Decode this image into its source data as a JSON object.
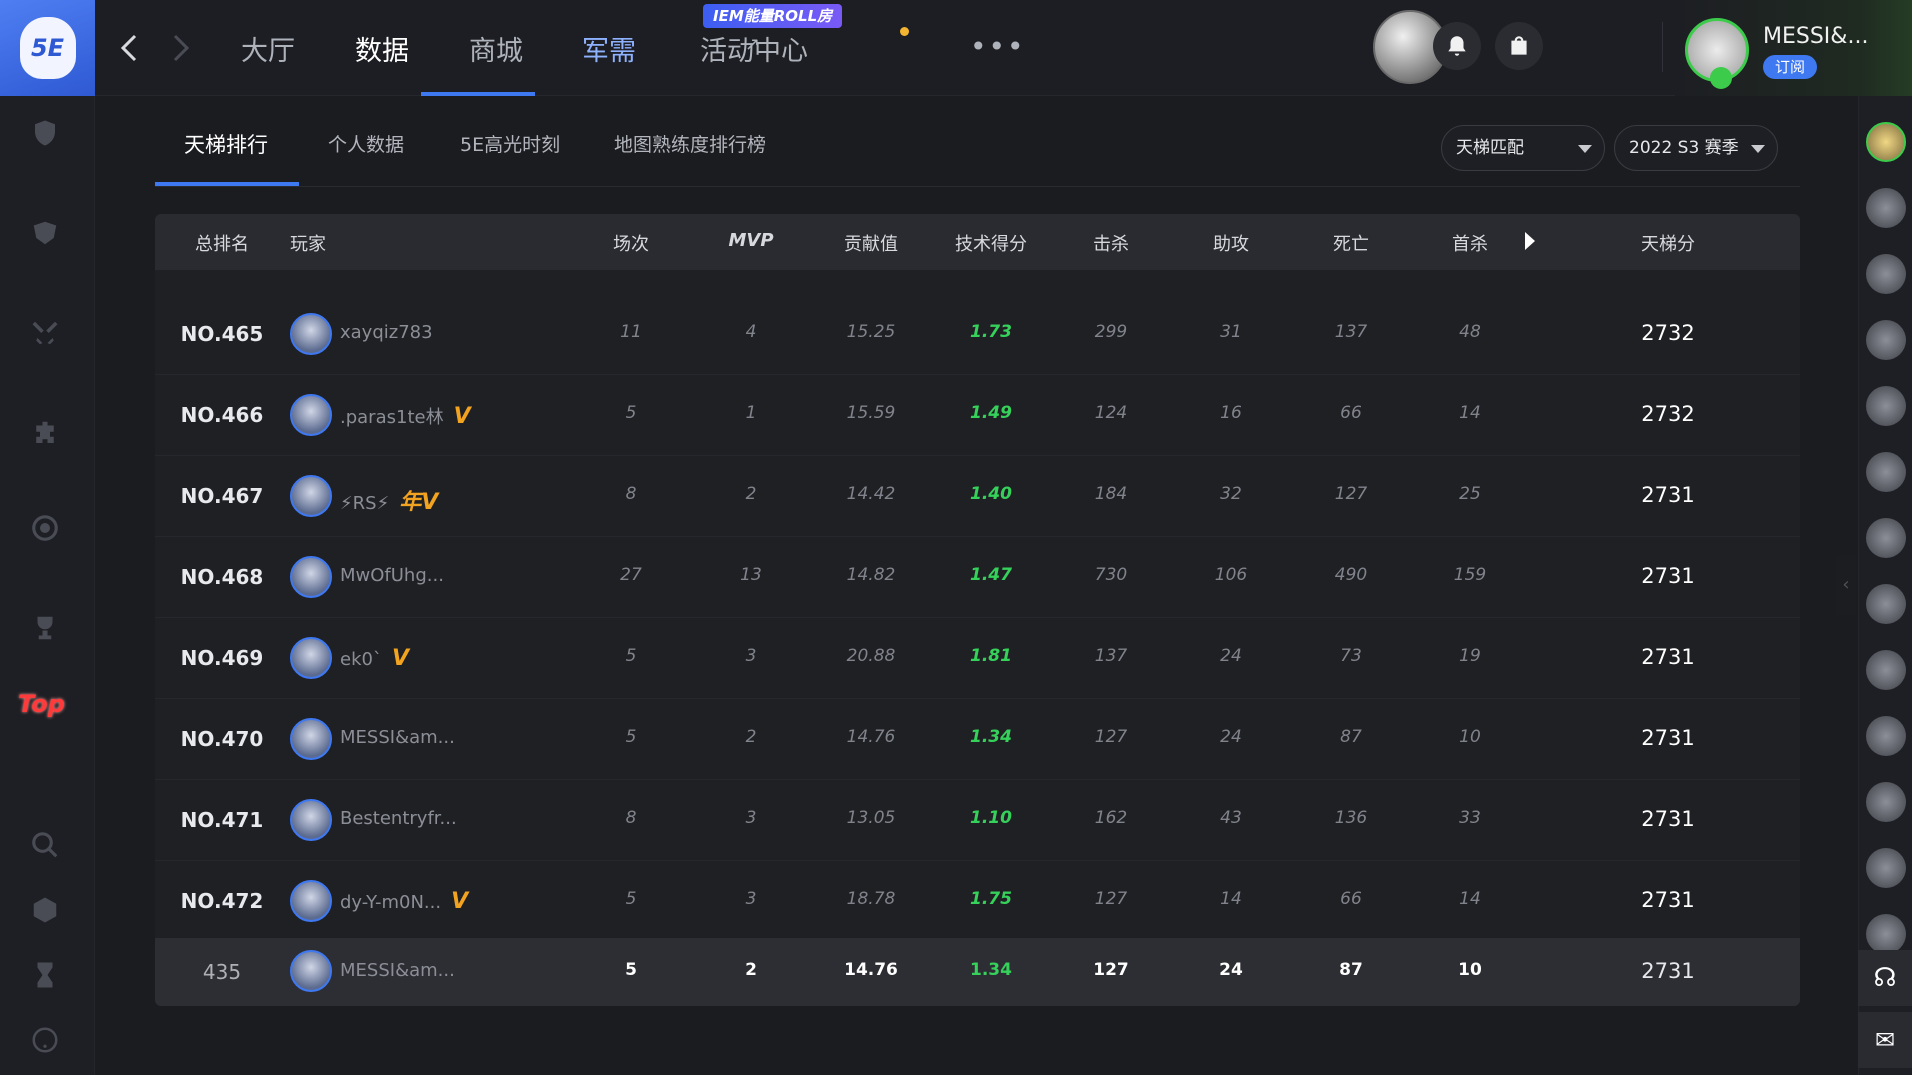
{
  "app": {
    "logo_text": "5E"
  },
  "nav": {
    "items": [
      {
        "label": "大厅"
      },
      {
        "label": "数据"
      },
      {
        "label": "商城"
      },
      {
        "label": "军需"
      },
      {
        "label": "活动中心"
      }
    ],
    "more": "•••",
    "promo_badge": "IEM能量ROLL房",
    "external_mark": "↗"
  },
  "user": {
    "name": "MESSI&...",
    "subscribe_label": "订阅"
  },
  "window": {
    "minimize": "—",
    "close": "✕"
  },
  "subtabs": [
    {
      "label": "天梯排行"
    },
    {
      "label": "个人数据"
    },
    {
      "label": "5E高光时刻"
    },
    {
      "label": "地图熟练度排行榜"
    }
  ],
  "filters": {
    "mode": "天梯匹配",
    "season": "2022 S3 赛季"
  },
  "sidebar": {
    "top_label": "Top"
  },
  "table": {
    "headers": {
      "rank": "总排名",
      "player": "玩家",
      "matches": "场次",
      "mvp": "MVP",
      "contribution": "贡献值",
      "tech": "技术得分",
      "kills": "击杀",
      "assists": "助攻",
      "deaths": "死亡",
      "first_kills": "首杀",
      "ladder": "天梯分"
    },
    "rows": [
      {
        "rank": "NO.465",
        "name": "xayqiz783",
        "badge": "",
        "matches": "11",
        "mvp": "4",
        "contribution": "15.25",
        "tech": "1.73",
        "kills": "299",
        "assists": "31",
        "deaths": "137",
        "first_kills": "48",
        "score": "2732"
      },
      {
        "rank": "NO.466",
        "name": ".paras1te林",
        "badge": "V",
        "matches": "5",
        "mvp": "1",
        "contribution": "15.59",
        "tech": "1.49",
        "kills": "124",
        "assists": "16",
        "deaths": "66",
        "first_kills": "14",
        "score": "2732"
      },
      {
        "rank": "NO.467",
        "name": "⚡RS⚡",
        "badge": "年V",
        "matches": "8",
        "mvp": "2",
        "contribution": "14.42",
        "tech": "1.40",
        "kills": "184",
        "assists": "32",
        "deaths": "127",
        "first_kills": "25",
        "score": "2731"
      },
      {
        "rank": "NO.468",
        "name": "MwOfUhg...",
        "badge": "",
        "matches": "27",
        "mvp": "13",
        "contribution": "14.82",
        "tech": "1.47",
        "kills": "730",
        "assists": "106",
        "deaths": "490",
        "first_kills": "159",
        "score": "2731"
      },
      {
        "rank": "NO.469",
        "name": "ek0`",
        "badge": "V",
        "matches": "5",
        "mvp": "3",
        "contribution": "20.88",
        "tech": "1.81",
        "kills": "137",
        "assists": "24",
        "deaths": "73",
        "first_kills": "19",
        "score": "2731"
      },
      {
        "rank": "NO.470",
        "name": "MESSI&am...",
        "badge": "",
        "matches": "5",
        "mvp": "2",
        "contribution": "14.76",
        "tech": "1.34",
        "kills": "127",
        "assists": "24",
        "deaths": "87",
        "first_kills": "10",
        "score": "2731"
      },
      {
        "rank": "NO.471",
        "name": "Bestentryfr...",
        "badge": "",
        "matches": "8",
        "mvp": "3",
        "contribution": "13.05",
        "tech": "1.10",
        "kills": "162",
        "assists": "43",
        "deaths": "136",
        "first_kills": "33",
        "score": "2731"
      },
      {
        "rank": "NO.472",
        "name": "dy-Y-m0N...",
        "badge": "V",
        "matches": "5",
        "mvp": "3",
        "contribution": "18.78",
        "tech": "1.75",
        "kills": "127",
        "assists": "14",
        "deaths": "66",
        "first_kills": "14",
        "score": "2731"
      }
    ],
    "self_row": {
      "rank": "435",
      "name": "MESSI&am...",
      "matches": "5",
      "mvp": "2",
      "contribution": "14.76",
      "tech": "1.34",
      "kills": "127",
      "assists": "24",
      "deaths": "87",
      "first_kills": "10",
      "score": "2731"
    }
  },
  "colors": {
    "accent": "#3f79f2",
    "tech_green": "#35d15a",
    "vip_orange": "#f2a31f",
    "top_red": "#ff3a3a"
  }
}
